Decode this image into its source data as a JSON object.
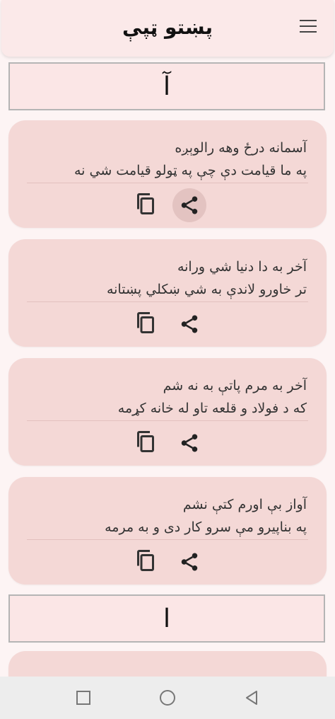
{
  "app": {
    "title": "پښتو ټپې"
  },
  "sections": [
    {
      "letter": "آ"
    },
    {
      "letter": "ا"
    }
  ],
  "cards": [
    {
      "line1": "آسمانه درځ وهه رالوېږه",
      "line2": "په ما قيامت دې چې په ټولو قيامت شي نه"
    },
    {
      "line1": "آخر به دا دنيا شي ورانه",
      "line2": "تر خاورو لاندې به شي ښکلي پښتانه"
    },
    {
      "line1": "آخر به مرم پاتې به نه شم",
      "line2": "که د فولاد و قلعه تاو له خانه کړمه"
    },
    {
      "line1": "آواز بې اورم کتې نشم",
      "line2": "په بناپيرو مې سرو کار دی و به مرمه"
    }
  ],
  "icons": {
    "menu": "menu-icon",
    "copy": "copy-icon",
    "share": "share-icon"
  },
  "colors": {
    "card": "#f4d8d6",
    "header": "#fbe6e6",
    "appbar": "#fbe9e9",
    "accent": "#e3c3c1"
  }
}
